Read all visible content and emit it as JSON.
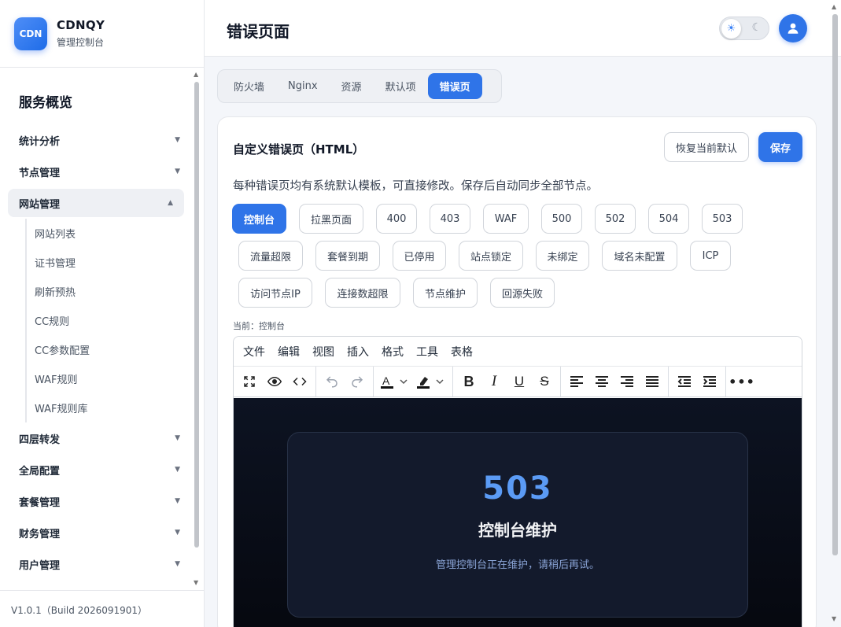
{
  "brand": {
    "logo": "CDN",
    "name": "CDNQY",
    "subtitle": "管理控制台"
  },
  "sidebar": {
    "title": "服务概览",
    "groups": [
      {
        "label": "统计分析"
      },
      {
        "label": "节点管理"
      },
      {
        "label": "网站管理",
        "open": true,
        "items": [
          "网站列表",
          "证书管理",
          "刷新预热",
          "CC规则",
          "CC参数配置",
          "WAF规则",
          "WAF规则库"
        ]
      },
      {
        "label": "四层转发"
      },
      {
        "label": "全局配置"
      },
      {
        "label": "套餐管理"
      },
      {
        "label": "财务管理"
      },
      {
        "label": "用户管理"
      }
    ],
    "version": "V1.0.1（Build 2026091901）"
  },
  "header": {
    "title": "错误页面",
    "theme": "light"
  },
  "tabs": [
    "防火墙",
    "Nginx",
    "资源",
    "默认项",
    "错误页"
  ],
  "active_tab": "错误页",
  "card": {
    "title": "自定义错误页（HTML）",
    "restore_label": "恢复当前默认",
    "save_label": "保存",
    "description": "每种错误页均有系统默认模板，可直接修改。保存后自动同步全部节点。",
    "chip_rows": [
      [
        "控制台",
        "拉黑页面",
        "400",
        "403",
        "WAF",
        "500",
        "502",
        "504",
        "503"
      ],
      [
        "流量超限",
        "套餐到期",
        "已停用",
        "站点锁定",
        "未绑定",
        "域名未配置",
        "ICP"
      ],
      [
        "访问节点IP",
        "连接数超限",
        "节点维护",
        "回源失败"
      ]
    ],
    "active_chip": "控制台",
    "current_label": "当前：控制台"
  },
  "editor": {
    "menu": [
      "文件",
      "编辑",
      "视图",
      "插入",
      "格式",
      "工具",
      "表格"
    ],
    "preview": {
      "code": "503",
      "title": "控制台维护",
      "message": "管理控制台正在维护，请稍后再试。"
    }
  },
  "colors": {
    "accent": "#2f74e8",
    "preview_bg": "#0b1020",
    "code": "#5b9bf5"
  }
}
